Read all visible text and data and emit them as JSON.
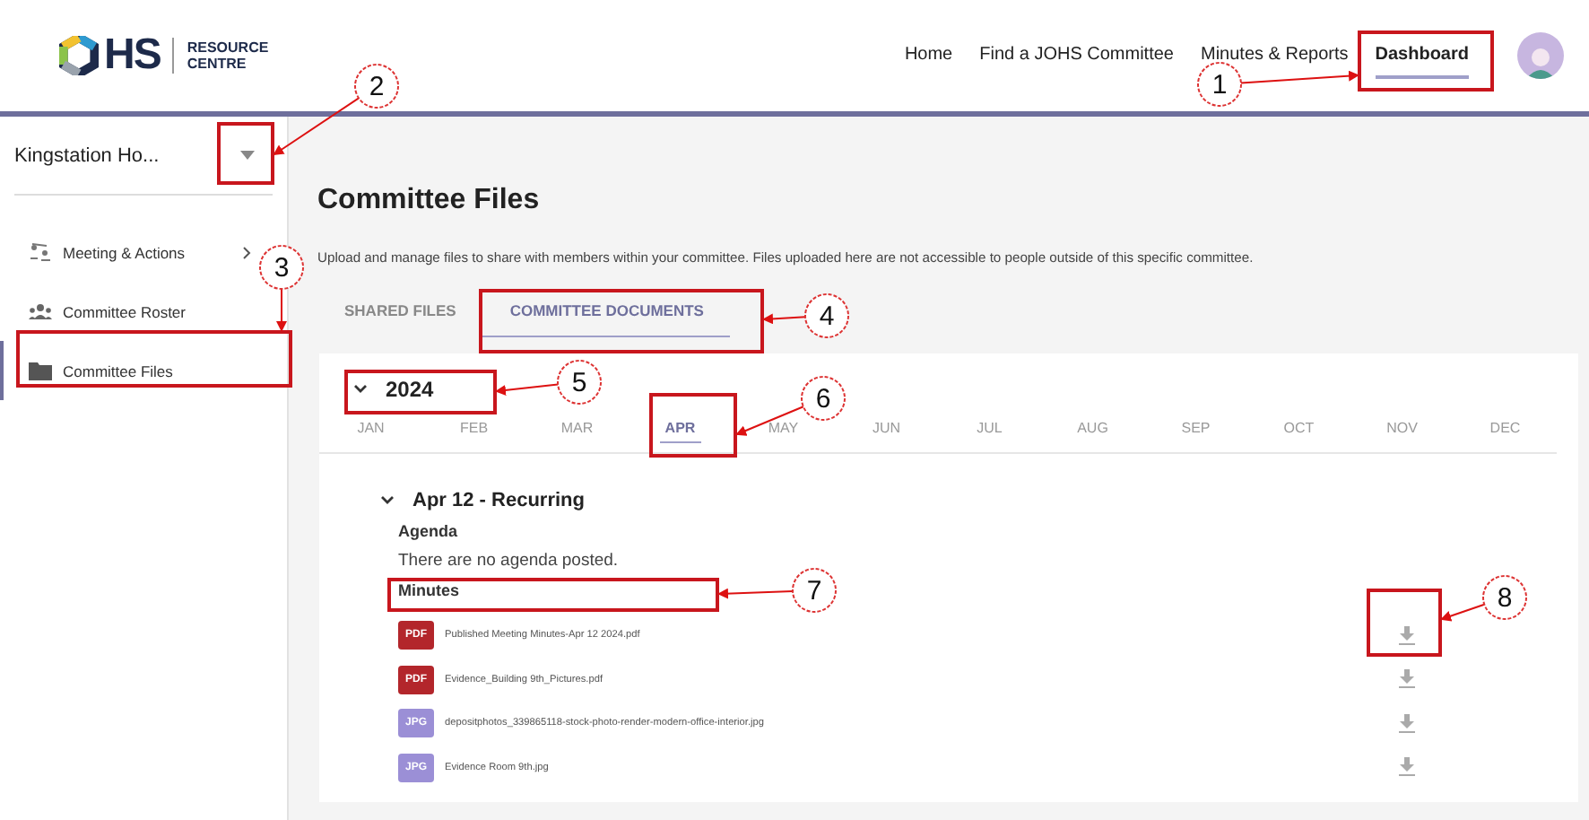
{
  "header": {
    "logo": {
      "mark": "HS",
      "line_1": "RESOURCE",
      "line_2": "CENTRE"
    },
    "nav": [
      {
        "label": "Home",
        "selected": false
      },
      {
        "label": "Find a JOHS Committee",
        "selected": false
      },
      {
        "label": "Minutes & Reports",
        "selected": false
      },
      {
        "label": "Dashboard",
        "selected": true
      }
    ]
  },
  "sidebar": {
    "committee": "Kingstation Ho...",
    "items": [
      {
        "label": "Meeting & Actions",
        "has_submenu": true,
        "selected": false
      },
      {
        "label": "Committee Roster",
        "has_submenu": false,
        "selected": false
      },
      {
        "label": "Committee Files",
        "has_submenu": false,
        "selected": true
      }
    ]
  },
  "main": {
    "title": "Committee Files",
    "description": "Upload and manage files to share with members within your committee. Files uploaded here are not accessible to people outside of this specific committee.",
    "tabs": [
      {
        "label": "SHARED FILES",
        "selected": false
      },
      {
        "label": "COMMITTEE DOCUMENTS",
        "selected": true
      }
    ],
    "year": {
      "label": "2024",
      "expanded": true
    },
    "months": [
      {
        "label": "JAN",
        "selected": false
      },
      {
        "label": "FEB",
        "selected": false
      },
      {
        "label": "MAR",
        "selected": false
      },
      {
        "label": "APR",
        "selected": true
      },
      {
        "label": "MAY",
        "selected": false
      },
      {
        "label": "JUN",
        "selected": false
      },
      {
        "label": "JUL",
        "selected": false
      },
      {
        "label": "AUG",
        "selected": false
      },
      {
        "label": "SEP",
        "selected": false
      },
      {
        "label": "OCT",
        "selected": false
      },
      {
        "label": "NOV",
        "selected": false
      },
      {
        "label": "DEC",
        "selected": false
      }
    ],
    "meeting": {
      "title": "Apr 12 - Recurring",
      "expanded": true,
      "agenda_heading": "Agenda",
      "agenda_empty": "There are no agenda posted.",
      "minutes_heading": "Minutes",
      "files": [
        {
          "badge": "PDF",
          "color": "#b3262b",
          "name": "Published Meeting Minutes-Apr 12 2024.pdf"
        },
        {
          "badge": "PDF",
          "color": "#b3262b",
          "name": "Evidence_Building 9th_Pictures.pdf"
        },
        {
          "badge": "JPG",
          "color": "#9b8fd6",
          "name": "depositphotos_339865118-stock-photo-render-modern-office-interior.jpg"
        },
        {
          "badge": "JPG",
          "color": "#9b8fd6",
          "name": "Evidence Room 9th.jpg"
        }
      ]
    }
  },
  "annotations": [
    {
      "number": "1"
    },
    {
      "number": "2"
    },
    {
      "number": "3"
    },
    {
      "number": "4"
    },
    {
      "number": "5"
    },
    {
      "number": "6"
    },
    {
      "number": "7"
    },
    {
      "number": "8"
    }
  ]
}
